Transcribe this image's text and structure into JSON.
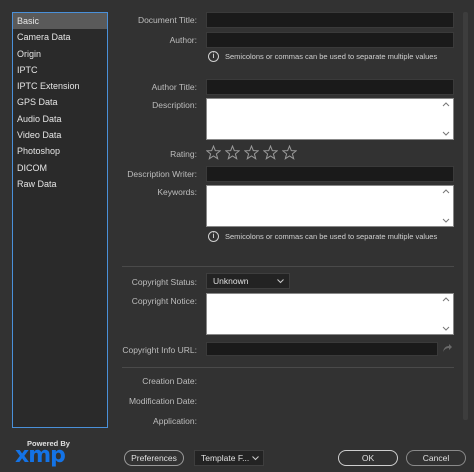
{
  "sidebar": {
    "items": [
      {
        "label": "Basic",
        "active": true
      },
      {
        "label": "Camera Data"
      },
      {
        "label": "Origin"
      },
      {
        "label": "IPTC"
      },
      {
        "label": "IPTC Extension"
      },
      {
        "label": "GPS Data"
      },
      {
        "label": "Audio Data"
      },
      {
        "label": "Video Data"
      },
      {
        "label": "Photoshop"
      },
      {
        "label": "DICOM"
      },
      {
        "label": "Raw Data"
      }
    ]
  },
  "fields": {
    "document_title": "Document Title:",
    "author": "Author:",
    "author_note": "Semicolons or commas can be used to separate multiple values",
    "author_title": "Author Title:",
    "description": "Description:",
    "rating": "Rating:",
    "rating_value": 0,
    "rating_max": 5,
    "description_writer": "Description Writer:",
    "keywords": "Keywords:",
    "keywords_note": "Semicolons or commas can be used to separate multiple values",
    "copyright_status": "Copyright Status:",
    "copyright_status_value": "Unknown",
    "copyright_notice": "Copyright Notice:",
    "copyright_info_url": "Copyright Info URL:",
    "creation_date": "Creation Date:",
    "modification_date": "Modification Date:",
    "application": "Application:"
  },
  "footer": {
    "powered_by": "Powered By",
    "xmp_logo": "xmp",
    "preferences": "Preferences",
    "template": "Template F...",
    "ok": "OK",
    "cancel": "Cancel"
  },
  "icons": {
    "info": "info-icon",
    "star": "star-icon",
    "chevron": "chevron-down-icon",
    "arrow": "go-arrow-icon"
  },
  "colors": {
    "background": "#323232",
    "sidebar_border": "#4a90d9",
    "active_item": "#5a5a5a",
    "xmp_blue": "#1473e6"
  }
}
